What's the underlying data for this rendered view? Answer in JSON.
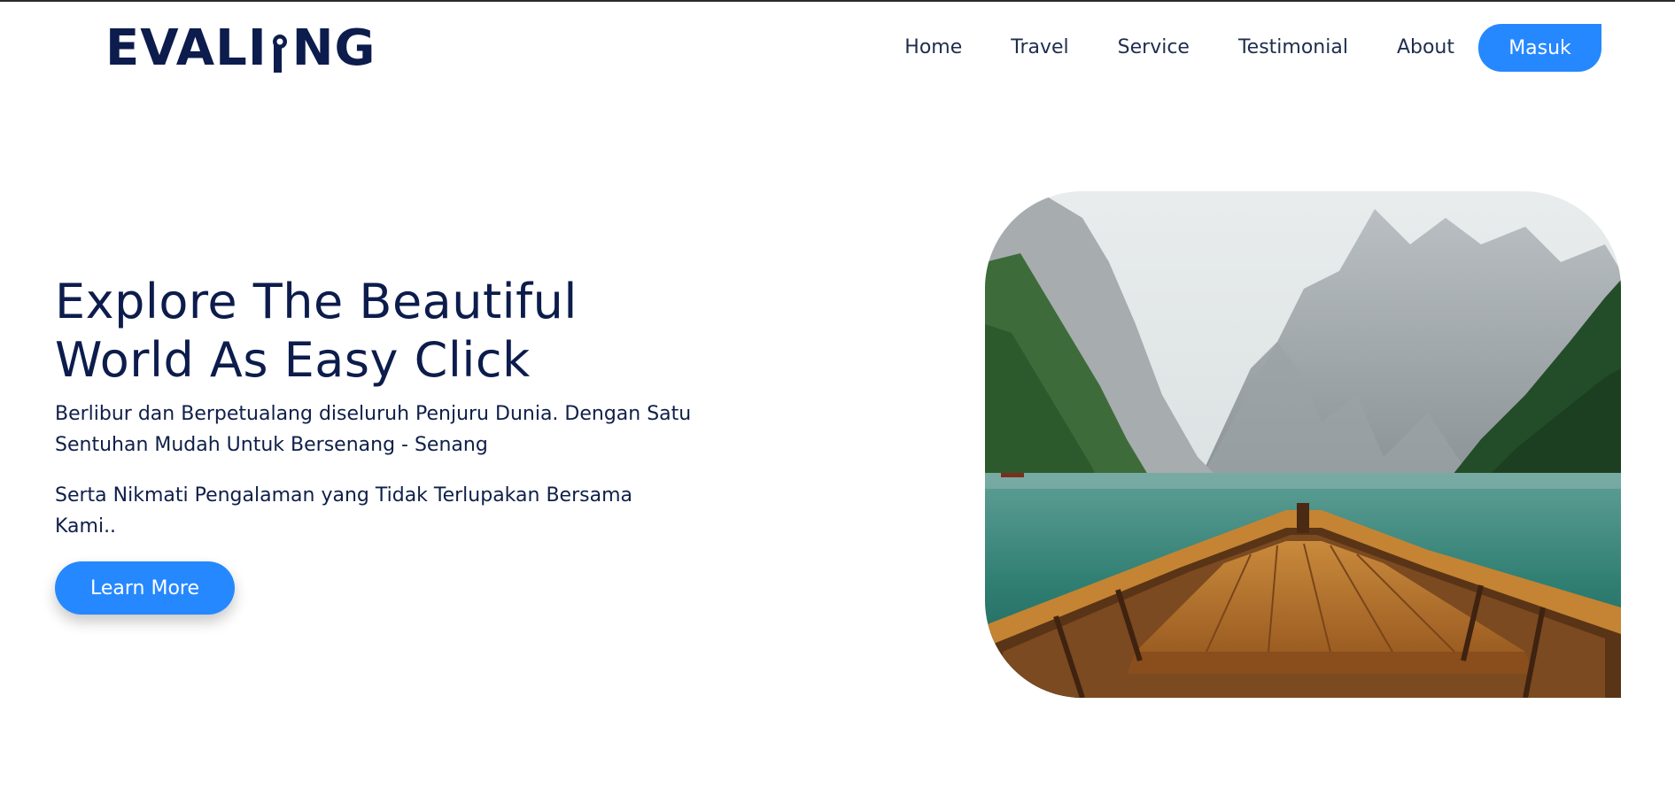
{
  "brand": {
    "logo_text_left": "EVALI",
    "logo_text_right": "NG",
    "color": "#0c1c4c"
  },
  "nav": {
    "items": [
      {
        "label": "Home"
      },
      {
        "label": "Travel"
      },
      {
        "label": "Service"
      },
      {
        "label": "Testimonial"
      },
      {
        "label": "About"
      }
    ],
    "login_label": "Masuk"
  },
  "hero": {
    "title_line1": "Explore The Beautiful",
    "title_line2": "World As Easy Click",
    "paragraph1": "Berlibur dan Berpetualang diseluruh Penjuru Dunia. Dengan Satu Sentuhan Mudah Untuk Bersenang - Senang",
    "paragraph2": "Serta Nikmati Pengalaman yang Tidak Terlupakan Bersama Kami..",
    "cta_label": "Learn More",
    "image_icon": "mountain-lake-boat-photo"
  },
  "colors": {
    "accent": "#2688ff",
    "text_dark": "#0c1c4c"
  }
}
